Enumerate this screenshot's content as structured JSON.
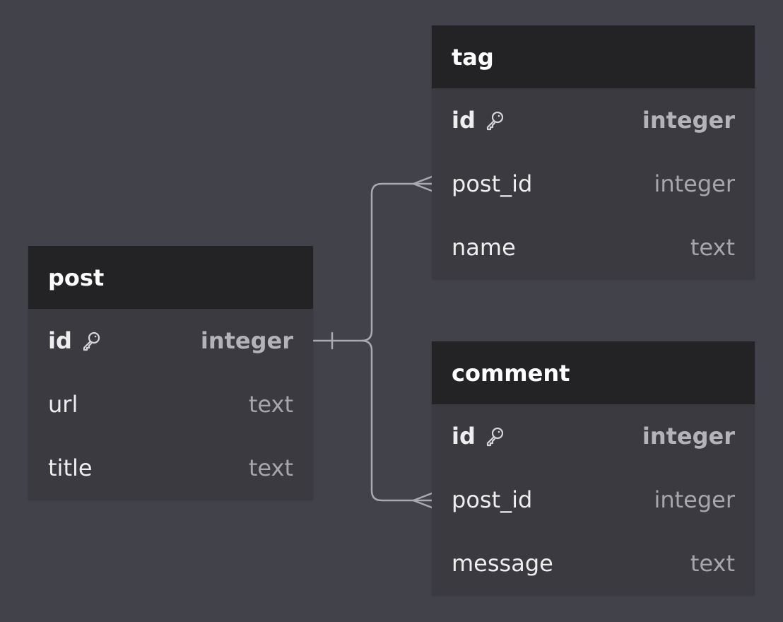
{
  "colors": {
    "background": "#42424b",
    "header": "#232325",
    "body": "#3a3a40",
    "connector": "#a9a9b0"
  },
  "entities": {
    "post": {
      "name": "post",
      "columns": [
        {
          "name": "id",
          "type": "integer",
          "primary_key": true,
          "icon": "key-icon"
        },
        {
          "name": "url",
          "type": "text"
        },
        {
          "name": "title",
          "type": "text"
        }
      ]
    },
    "tag": {
      "name": "tag",
      "columns": [
        {
          "name": "id",
          "type": "integer",
          "primary_key": true,
          "icon": "key-icon"
        },
        {
          "name": "post_id",
          "type": "integer"
        },
        {
          "name": "name",
          "type": "text"
        }
      ]
    },
    "comment": {
      "name": "comment",
      "columns": [
        {
          "name": "id",
          "type": "integer",
          "primary_key": true,
          "icon": "key-icon"
        },
        {
          "name": "post_id",
          "type": "integer"
        },
        {
          "name": "message",
          "type": "text"
        }
      ]
    }
  },
  "relationships": [
    {
      "from": "post.id",
      "to": "tag.post_id",
      "from_cardinality": "one",
      "to_cardinality": "many"
    },
    {
      "from": "post.id",
      "to": "comment.post_id",
      "from_cardinality": "one",
      "to_cardinality": "many"
    }
  ]
}
